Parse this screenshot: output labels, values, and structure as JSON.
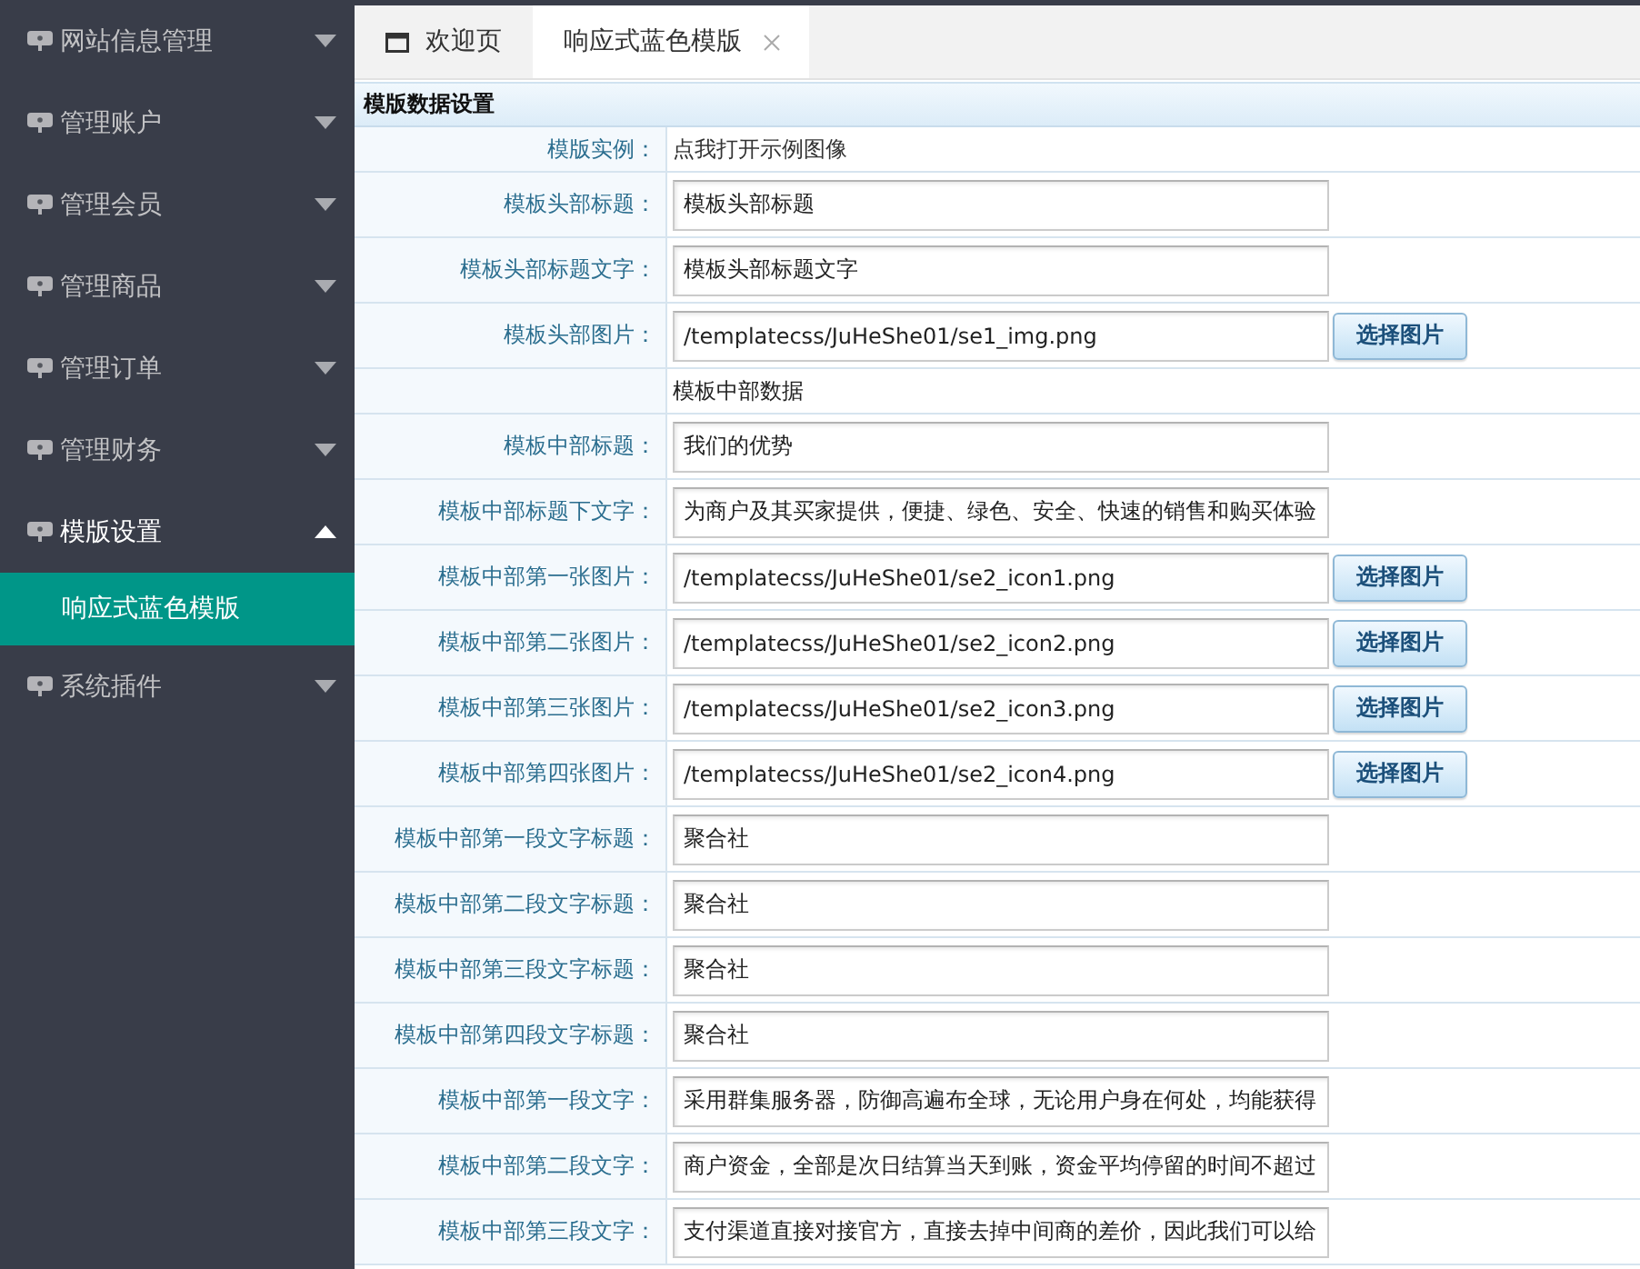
{
  "sidebar": {
    "items": [
      {
        "label": "网站信息管理",
        "expanded": false
      },
      {
        "label": "管理账户",
        "expanded": false
      },
      {
        "label": "管理会员",
        "expanded": false
      },
      {
        "label": "管理商品",
        "expanded": false
      },
      {
        "label": "管理订单",
        "expanded": false
      },
      {
        "label": "管理财务",
        "expanded": false
      },
      {
        "label": "模版设置",
        "expanded": true,
        "children": [
          {
            "label": "响应式蓝色模版",
            "selected": true
          }
        ]
      },
      {
        "label": "系统插件",
        "expanded": false
      }
    ]
  },
  "tabs": [
    {
      "label": "欢迎页",
      "kind": "home",
      "selected": false,
      "closable": false
    },
    {
      "label": "响应式蓝色模版",
      "kind": "page",
      "selected": true,
      "closable": true
    }
  ],
  "form": {
    "title": "模版数据设置",
    "rows": [
      {
        "kind": "link",
        "label": "模版实例：",
        "value": "点我打开示例图像"
      },
      {
        "kind": "text",
        "label": "模板头部标题：",
        "value": "模板头部标题"
      },
      {
        "kind": "text",
        "label": "模板头部标题文字：",
        "value": "模板头部标题文字"
      },
      {
        "kind": "image",
        "label": "模板头部图片：",
        "value": "/templatecss/JuHeShe01/se1_img.png",
        "button": "选择图片"
      },
      {
        "kind": "section",
        "value": "模板中部数据"
      },
      {
        "kind": "text",
        "label": "模板中部标题：",
        "value": "我们的优势"
      },
      {
        "kind": "text",
        "label": "模板中部标题下文字：",
        "value": "为商户及其买家提供，便捷、绿色、安全、快速的销售和购买体验"
      },
      {
        "kind": "image",
        "label": "模板中部第一张图片：",
        "value": "/templatecss/JuHeShe01/se2_icon1.png",
        "button": "选择图片"
      },
      {
        "kind": "image",
        "label": "模板中部第二张图片：",
        "value": "/templatecss/JuHeShe01/se2_icon2.png",
        "button": "选择图片"
      },
      {
        "kind": "image",
        "label": "模板中部第三张图片：",
        "value": "/templatecss/JuHeShe01/se2_icon3.png",
        "button": "选择图片"
      },
      {
        "kind": "image",
        "label": "模板中部第四张图片：",
        "value": "/templatecss/JuHeShe01/se2_icon4.png",
        "button": "选择图片"
      },
      {
        "kind": "text",
        "label": "模板中部第一段文字标题：",
        "value": "聚合社"
      },
      {
        "kind": "text",
        "label": "模板中部第二段文字标题：",
        "value": "聚合社"
      },
      {
        "kind": "text",
        "label": "模板中部第三段文字标题：",
        "value": "聚合社"
      },
      {
        "kind": "text",
        "label": "模板中部第四段文字标题：",
        "value": "聚合社"
      },
      {
        "kind": "text",
        "label": "模板中部第一段文字：",
        "value": "采用群集服务器，防御高遍布全球，无论用户身在何处，均能获得"
      },
      {
        "kind": "text",
        "label": "模板中部第二段文字：",
        "value": "商户资金，全部是次日结算当天到账，资金平均停留的时间不超过"
      },
      {
        "kind": "text",
        "label": "模板中部第三段文字：",
        "value": "支付渠道直接对接官方，直接去掉中间商的差价，因此我们可以给"
      }
    ]
  }
}
